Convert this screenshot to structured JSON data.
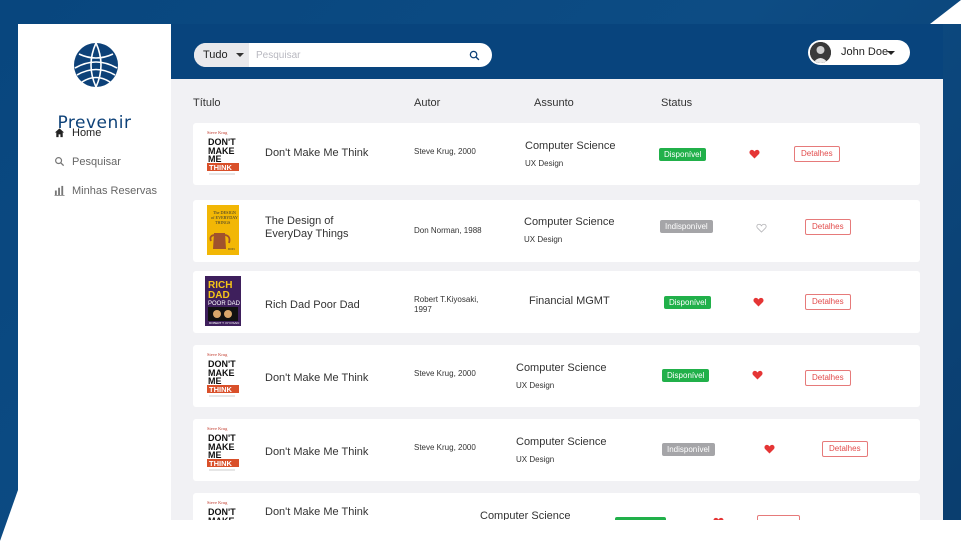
{
  "app": {
    "brand": "Prevenir"
  },
  "sidebar": {
    "items": [
      {
        "label": "Home",
        "icon": "home-icon"
      },
      {
        "label": "Pesquisar",
        "icon": "search-icon"
      },
      {
        "label": "Minhas Reservas",
        "icon": "chart-icon"
      }
    ]
  },
  "search": {
    "scope": "Tudo",
    "placeholder": "Pesquisar"
  },
  "user": {
    "name": "John Doe"
  },
  "columns": {
    "title": "Título",
    "author": "Autor",
    "subject": "Assunto",
    "status": "Status"
  },
  "colors": {
    "primary": "#08447d",
    "available": "#21b04a",
    "unavailable": "#a5a5a8",
    "heart": "#e53535",
    "details": "#e24b4b"
  },
  "books": [
    {
      "title": "Don't Make Me Think",
      "author": "Steve Krug, 2000",
      "subject": "Computer Science",
      "subsubject": "UX Design",
      "status": "Disponível",
      "available": true,
      "favorite": true,
      "details": "Detalhes",
      "cover": "dont-make-me-think"
    },
    {
      "title": "The Design of EveryDay Things",
      "author": "Don Norman, 1988",
      "subject": "Computer Science",
      "subsubject": "UX Design",
      "status": "Indisponível",
      "available": false,
      "favorite": false,
      "details": "Detalhes",
      "cover": "design-of-everyday-things"
    },
    {
      "title": "Rich Dad Poor Dad",
      "author": "Robert T.Kiyosaki, 1997",
      "subject": "Financial MGMT",
      "subsubject": "",
      "status": "Disponível",
      "available": true,
      "favorite": true,
      "details": "Detalhes",
      "cover": "rich-dad-poor-dad"
    },
    {
      "title": "Don't Make Me Think",
      "author": "Steve Krug, 2000",
      "subject": "Computer Science",
      "subsubject": "UX Design",
      "status": "Disponível",
      "available": true,
      "favorite": true,
      "details": "Detalhes",
      "cover": "dont-make-me-think"
    },
    {
      "title": "Don't Make Me Think",
      "author": "Steve Krug, 2000",
      "subject": "Computer Science",
      "subsubject": "UX Design",
      "status": "Indisponível",
      "available": false,
      "favorite": true,
      "details": "Detalhes",
      "cover": "dont-make-me-think"
    },
    {
      "title": "Don't Make Me Think",
      "author": "",
      "subject": "Computer Science",
      "subsubject": "",
      "status": "",
      "available": true,
      "favorite": true,
      "details": "",
      "cover": "dont-make-me-think"
    }
  ]
}
